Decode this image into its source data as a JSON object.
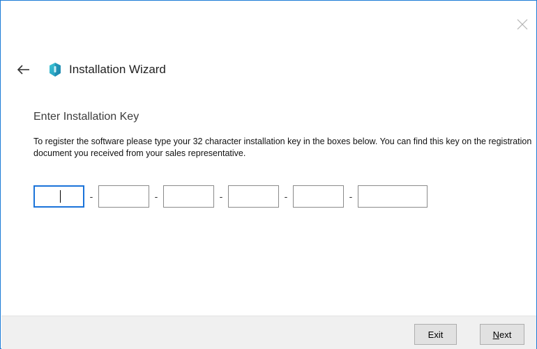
{
  "window": {
    "close_icon": "close-icon",
    "accent_color": "#1b7bd6"
  },
  "header": {
    "back_icon": "arrow-left-icon",
    "app_icon": "wizard-shield-icon",
    "title": "Installation Wizard"
  },
  "section": {
    "title": "Enter Installation Key",
    "description": "To register the software please type your 32 character installation key in the boxes below. You can find this key on the registration document you received from your sales representative."
  },
  "key_fields": {
    "separator": "-",
    "values": [
      "",
      "",
      "",
      "",
      "",
      ""
    ],
    "focused_index": 0
  },
  "footer": {
    "exit_label": "Exit",
    "next_label_mnemonic": "N",
    "next_label_rest": "ext"
  }
}
